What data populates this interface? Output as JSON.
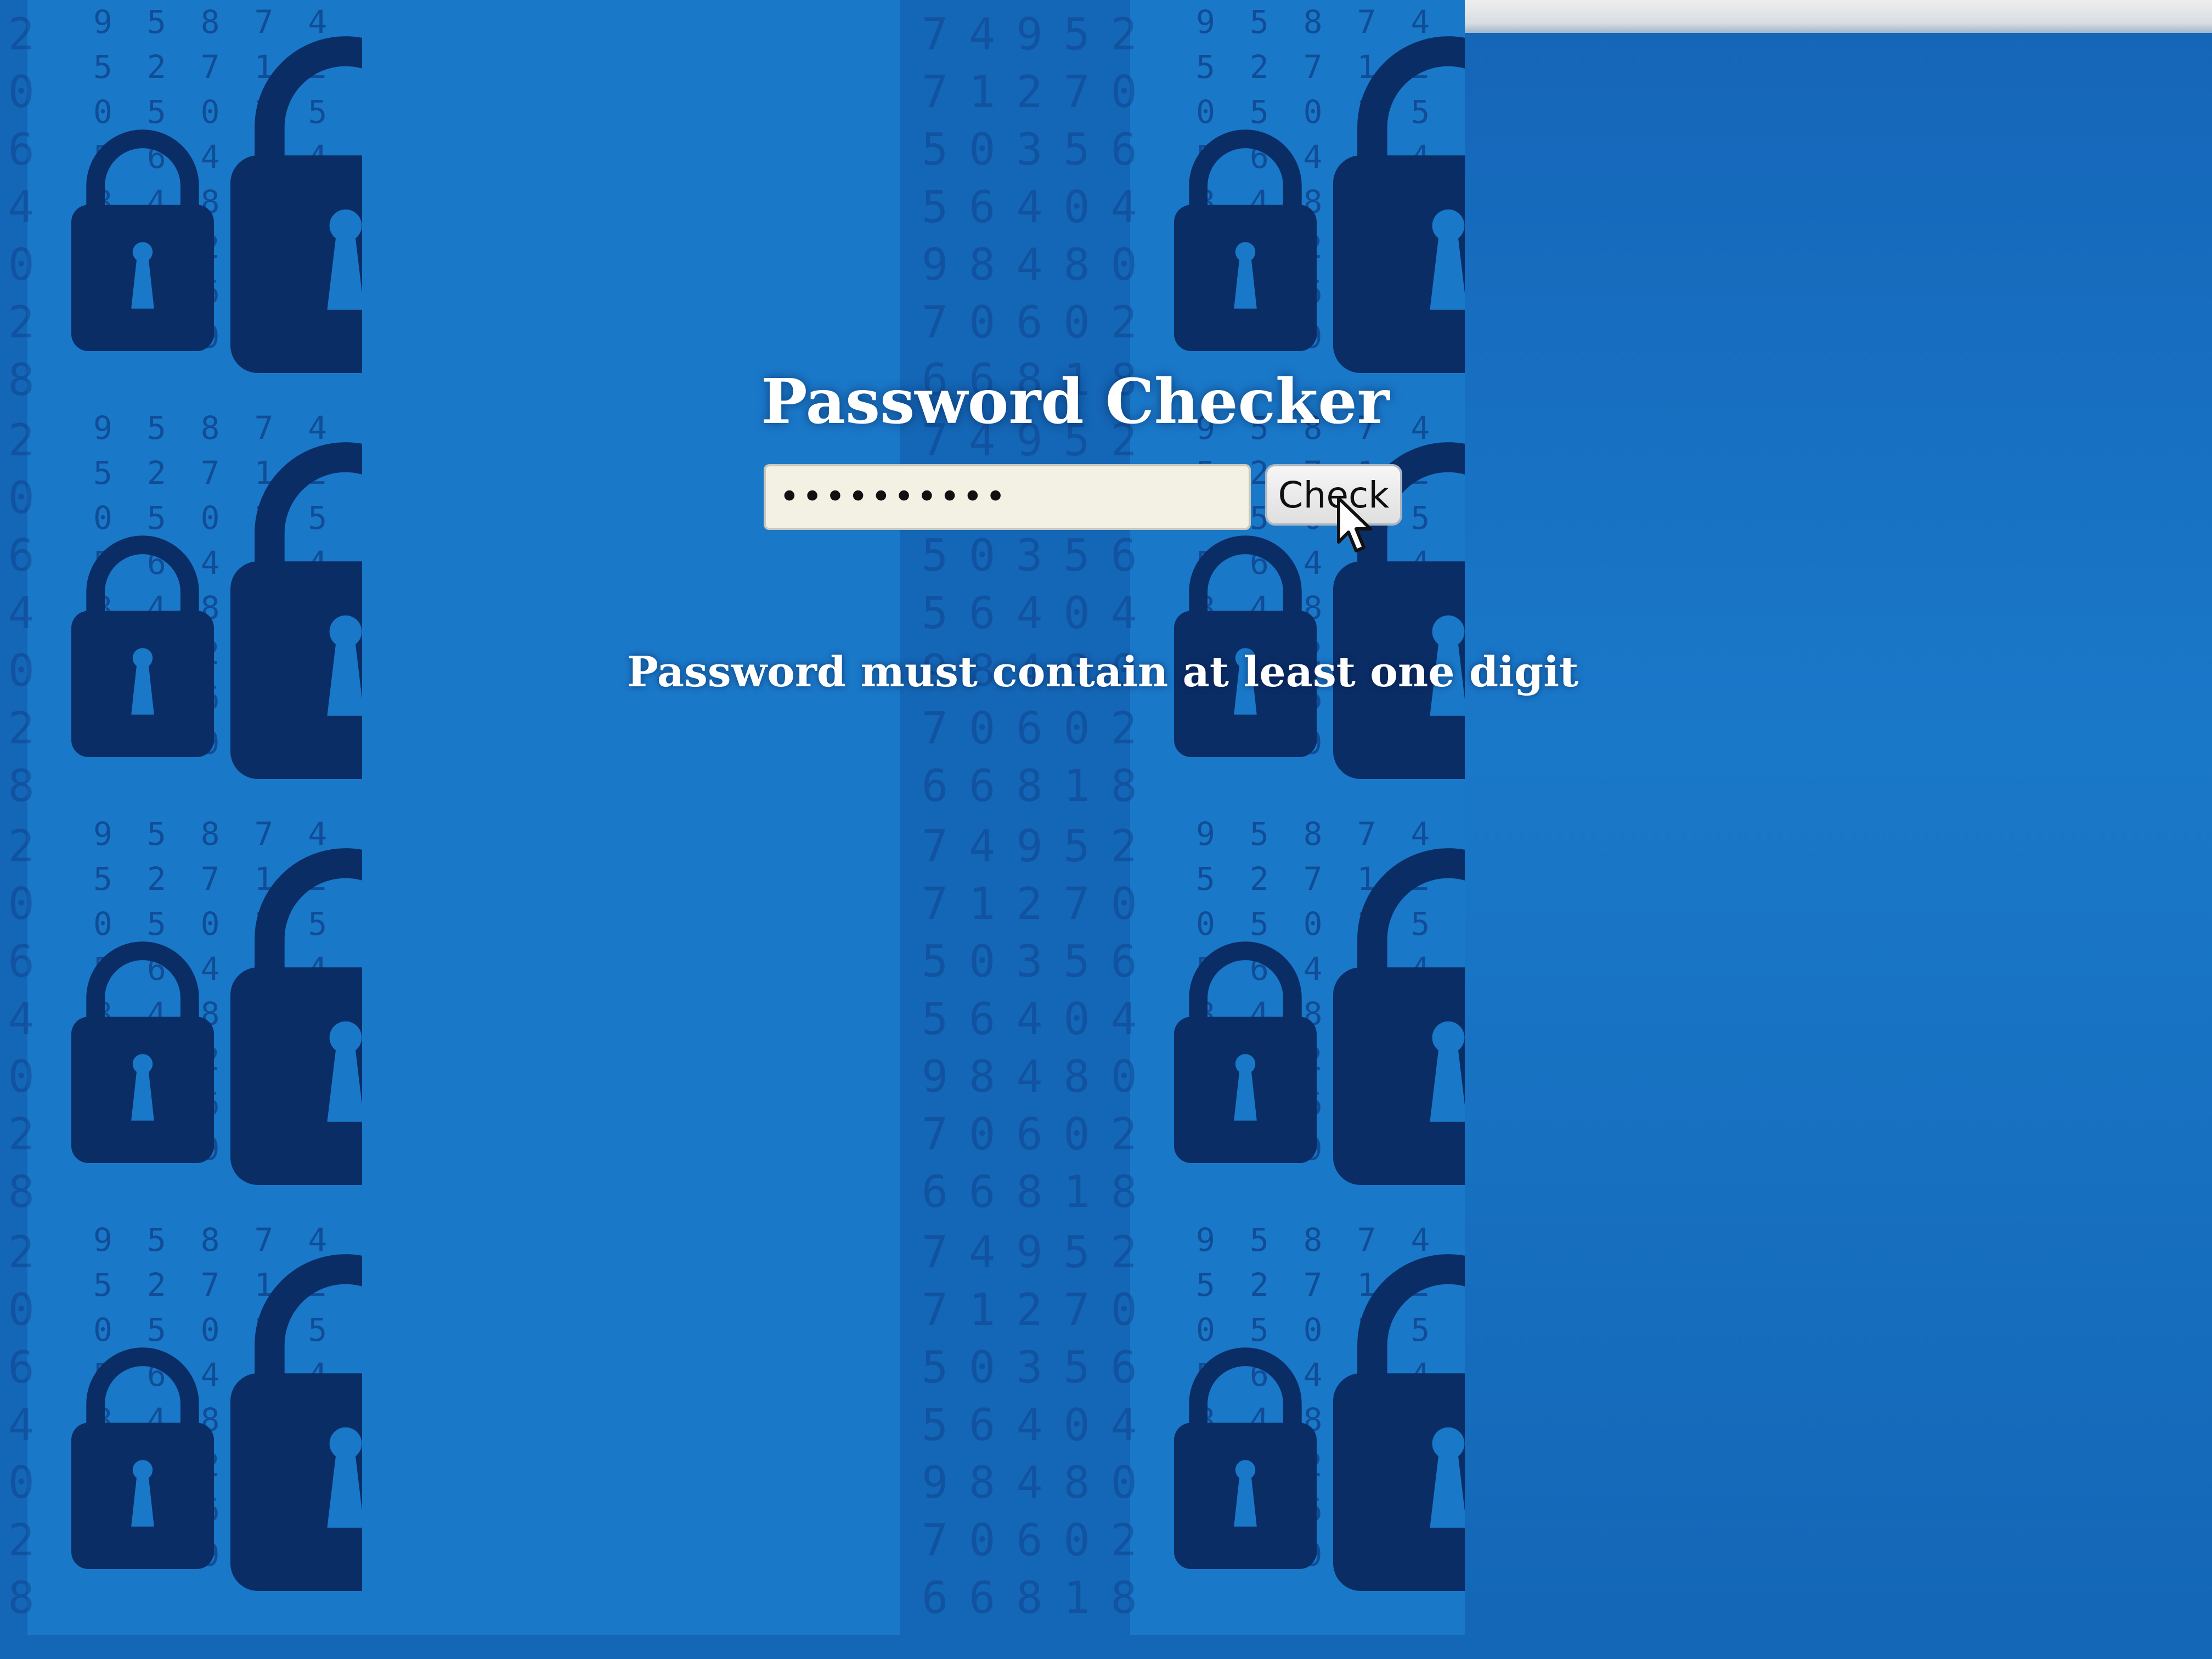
{
  "app": {
    "title": "Password Checker"
  },
  "form": {
    "password_value": "••••••••••",
    "check_label": "Check"
  },
  "feedback": {
    "message": "Password must contain at least one digit"
  },
  "wallpaper": {
    "digits": "958749527127050356564049848070602668186933565",
    "icon": "padlock-icon",
    "colors": {
      "lock": "#0b2d66",
      "background": "#1a78c9",
      "digits": "#0f3f86"
    }
  },
  "colors": {
    "title_text": "#ffffff",
    "message_text": "#ffffff",
    "input_bg": "#f3f1e4",
    "button_bg": "#e8e8e8"
  }
}
